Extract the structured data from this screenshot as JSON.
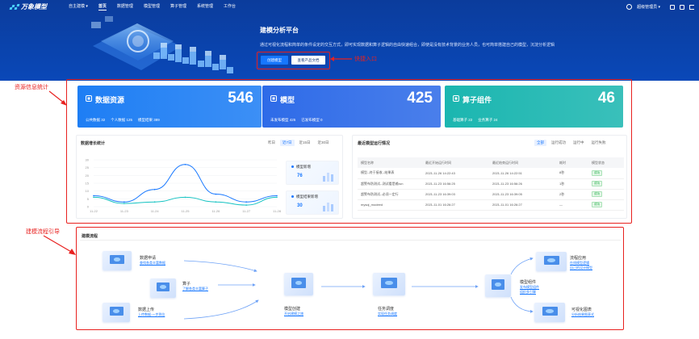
{
  "nav": {
    "logo": "万象模型",
    "items": [
      {
        "label": "自主建模 ▾",
        "active": false
      },
      {
        "label": "首页",
        "active": true
      },
      {
        "label": "数据管理",
        "active": false
      },
      {
        "label": "模型管理",
        "active": false
      },
      {
        "label": "算子管理",
        "active": false
      },
      {
        "label": "系统管理",
        "active": false
      },
      {
        "label": "工作台",
        "active": false
      }
    ],
    "user": "超级管理员 ▾"
  },
  "hero": {
    "title": "建模分析平台",
    "desc": "通过可视化流程和简单的条件设定的交互方式，即可实现数据和算子逻辑的自由快速组合，即使是没有技术背景的业务人员，也可简单搭建自己的模型，沉淀分析逻辑",
    "btn_create": "创建模型",
    "btn_docs": "查看产品文档"
  },
  "annotations": {
    "quick_entry": "快捷入口",
    "resource_stats": "资源信息统计",
    "flow_guide": "建模流程引导"
  },
  "cards": [
    {
      "title": "数据资源",
      "total": "546",
      "color": "#1e7ef4",
      "subs": [
        "公共数据 32",
        "个人数据 125",
        "模型结果 389"
      ]
    },
    {
      "title": "模型",
      "total": "425",
      "color": "#2e6be8",
      "subs": [
        "未发布模型 425",
        "已发布模型 0"
      ]
    },
    {
      "title": "算子组件",
      "total": "46",
      "color": "#1bb6b0",
      "subs": [
        "基础算子 22",
        "业务算子 24"
      ]
    }
  ],
  "growth": {
    "title": "数据增长统计",
    "tabs": [
      "昨日",
      "近7日",
      "近15日",
      "近30日"
    ],
    "active_tab": 1,
    "mini": [
      {
        "label": "模型新增",
        "value": "76"
      },
      {
        "label": "模型结果新增",
        "value": "30"
      }
    ]
  },
  "chart_data": {
    "type": "line",
    "x": [
      "11-22",
      "11-23",
      "11-24",
      "11-25",
      "11-26",
      "11-27",
      "11-28"
    ],
    "ylim": [
      0,
      30
    ],
    "yticks": [
      "30",
      "25",
      "20",
      "15",
      "10",
      "5",
      "0"
    ],
    "series": [
      {
        "values": [
          7,
          3,
          11,
          27,
          8,
          3,
          7
        ],
        "color": "#1677ff"
      },
      {
        "values": [
          6,
          2,
          3,
          6,
          3,
          1,
          6
        ],
        "color": "#13c2c2"
      }
    ]
  },
  "runs": {
    "title": "最近模型运行情况",
    "tabs": [
      "全部",
      "运行成功",
      "运行中",
      "运行失败"
    ],
    "active_tab": 0,
    "columns": [
      "模型名称",
      "最近开始运行时间",
      "最近结束运行时间",
      "耗时",
      "模型状态"
    ],
    "rows": [
      [
        "模型--终于接收--结果表",
        "2021-11-26 14:22:43",
        "2021-11-26 14:22:51",
        "8秒",
        "成功"
      ],
      [
        "超警布防测试--测试看是输run",
        "2021-11-23 16:56:25",
        "2021-11-23 16:56:26",
        "1秒",
        "成功"
      ],
      [
        "超警布防测试--必须一定行",
        "2021-11-23 16:39:03",
        "2021-11-23 16:39:05",
        "2秒",
        "成功"
      ],
      [
        "mysql_modeed",
        "2021-11-01 16:26:27",
        "2021-11-01 16:26:27",
        "—",
        "成功"
      ]
    ]
  },
  "flow": {
    "title": "建模流程",
    "nodes": {
      "apply": {
        "title": "数据申请",
        "link": "查找各类丰富数据"
      },
      "upload": {
        "title": "数据上传",
        "link": "上传数据·一步到位"
      },
      "operator": {
        "title": "算子",
        "link": "了解各类丰富算子"
      },
      "build": {
        "title": "模型创建",
        "link": "开启建模之旅"
      },
      "schedule": {
        "title": "任务调度",
        "link": "实现任务调度"
      },
      "publish": {
        "title": "模型组件",
        "link1": "发布模型组件",
        "link2": "组织多引擎"
      },
      "outflow": {
        "title": "流程应用",
        "link1": "在线模型逻辑",
        "link2": "自己的设计模型"
      },
      "viz": {
        "title": "可视化图表",
        "link": "分析结果图表式"
      }
    }
  }
}
